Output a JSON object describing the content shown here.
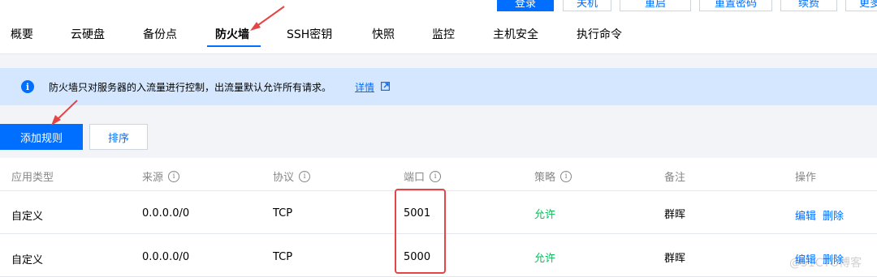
{
  "top_actions": [
    "登录",
    "关机",
    "重启",
    "重置密码",
    "续费",
    "更多"
  ],
  "tabs": [
    "概要",
    "云硬盘",
    "备份点",
    "防火墙",
    "SSH密钥",
    "快照",
    "监控",
    "主机安全",
    "执行命令"
  ],
  "active_tab": "防火墙",
  "banner": {
    "icon": "info-icon",
    "text": "防火墙只对服务器的入流量进行控制，出流量默认允许所有请求。",
    "link": "详情"
  },
  "toolbar": {
    "add_label": "添加规则",
    "sort_label": "排序"
  },
  "table": {
    "headers": [
      "应用类型",
      "来源",
      "协议",
      "端口",
      "策略",
      "备注",
      "操作"
    ],
    "rows": [
      {
        "type": "自定义",
        "source": "0.0.0.0/0",
        "protocol": "TCP",
        "port": "5001",
        "policy": "允许",
        "note": "群晖",
        "edit": "编辑",
        "delete": "删除"
      },
      {
        "type": "自定义",
        "source": "0.0.0.0/0",
        "protocol": "TCP",
        "port": "5000",
        "policy": "允许",
        "note": "群晖",
        "edit": "编辑",
        "delete": "删除"
      }
    ]
  },
  "watermark": "@51CTO博客",
  "colors": {
    "accent": "#006eff",
    "allow": "#0abf5b",
    "annotation": "#e54545",
    "banner_bg": "#d5e7ff",
    "page_bg": "#f2f4f8"
  }
}
